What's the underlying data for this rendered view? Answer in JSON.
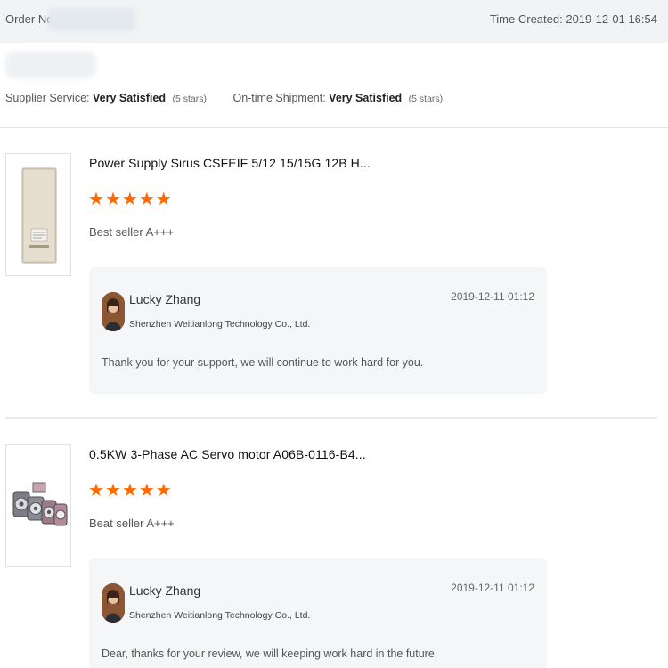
{
  "order": {
    "order_no_label": "Order No.:",
    "time_created_label": "Time Created:",
    "time_created_value": "2019-12-01 16:54"
  },
  "ratings": {
    "supplier_service_label": "Supplier Service:",
    "supplier_service_value": "Very Satisfied",
    "supplier_service_stars": "(5 stars)",
    "shipment_label": "On-time Shipment:",
    "shipment_value": "Very Satisfied",
    "shipment_stars": "(5 stars)"
  },
  "reviews": [
    {
      "product_title": "Power Supply Sirus CSFEIF 5/12 15/15G 12B H...",
      "rating": 5,
      "review_text": "Best seller A+++",
      "reply": {
        "seller_name": "Lucky Zhang",
        "company": "Shenzhen Weitianlong Technology Co., Ltd.",
        "date": "2019-12-11 01:12",
        "text": "Thank you for your support, we will continue to work hard for you."
      }
    },
    {
      "product_title": "0.5KW 3-Phase AC Servo motor A06B-0116-B4...",
      "rating": 5,
      "review_text": "Beat seller A+++",
      "reply": {
        "seller_name": "Lucky Zhang",
        "company": "Shenzhen Weitianlong Technology Co., Ltd.",
        "date": "2019-12-11 01:12",
        "text": "Dear, thanks for your review, we will keeping work hard in the future."
      }
    }
  ],
  "star_glyph": "★",
  "colors": {
    "star": "#ff6a00",
    "reply_bg": "#f5f6f8",
    "header_bg": "#f2f3f5"
  }
}
